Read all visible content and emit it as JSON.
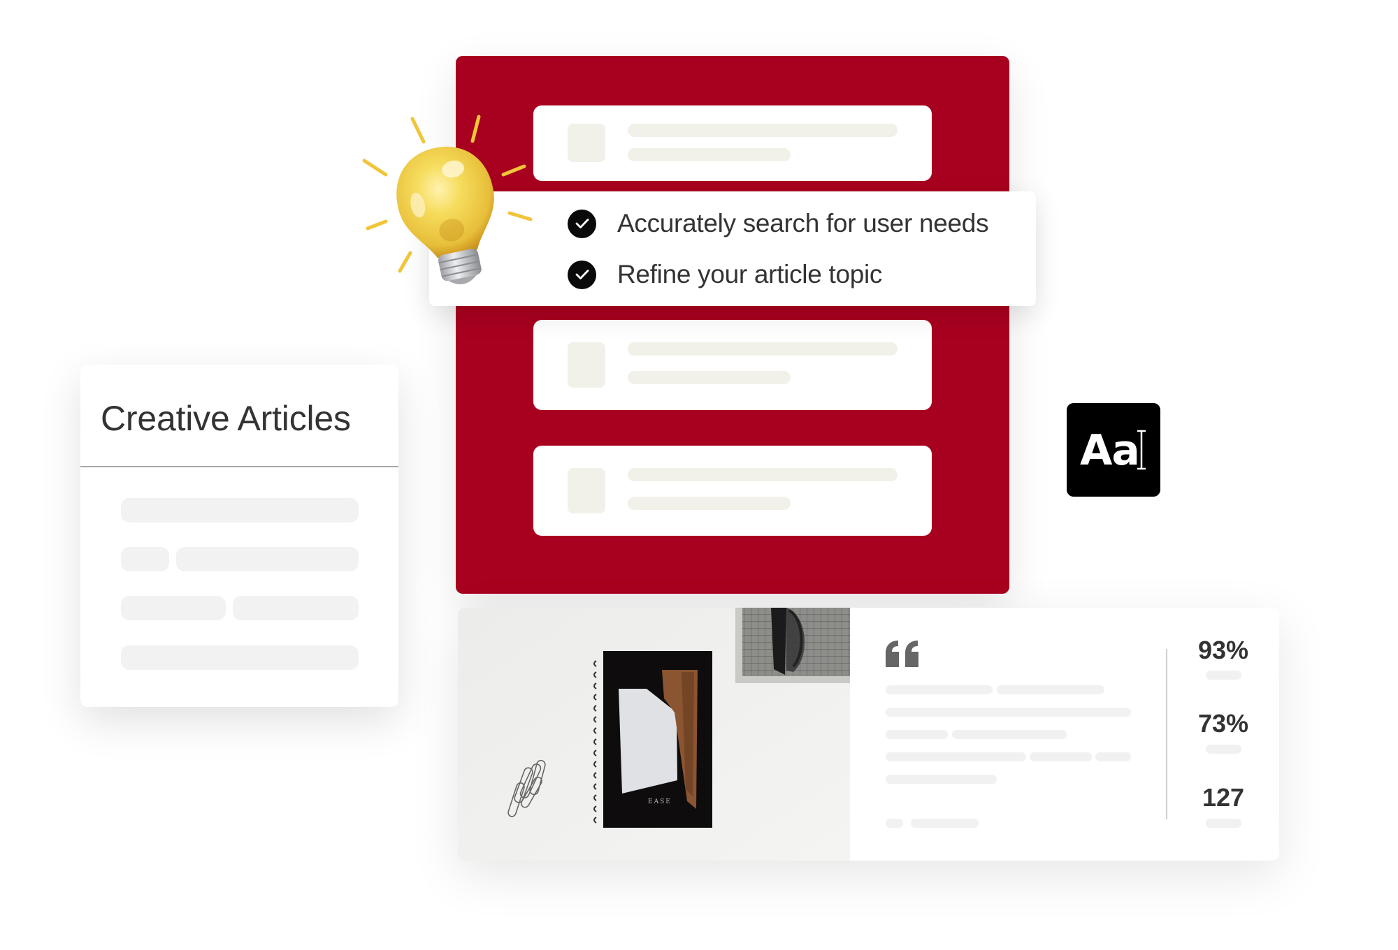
{
  "colors": {
    "brand_red": "#a8001f",
    "check_fill": "#0a0a0a",
    "skeleton_warm": "#f1f1ea",
    "skeleton_gray": "#f2f2f2",
    "text_dark": "#333333"
  },
  "feature_panel": {
    "list_cards": [
      {
        "name": "list-card-1"
      },
      {
        "name": "list-card-2"
      },
      {
        "name": "list-card-3"
      }
    ]
  },
  "checklist": {
    "items": [
      {
        "label": "Accurately search for user needs",
        "checked": true
      },
      {
        "label": "Refine your article topic",
        "checked": true
      }
    ]
  },
  "illustration": {
    "bulb_icon": "lightbulb-icon"
  },
  "articles_card": {
    "title": "Creative Articles"
  },
  "typography_badge": {
    "label": "Aa",
    "icon": "text-cursor-icon"
  },
  "stats_card": {
    "photo_caption": "EASE",
    "quote_icon": "quote-icon",
    "stats": [
      {
        "value": "93%"
      },
      {
        "value": "73%"
      },
      {
        "value": "127"
      }
    ]
  }
}
